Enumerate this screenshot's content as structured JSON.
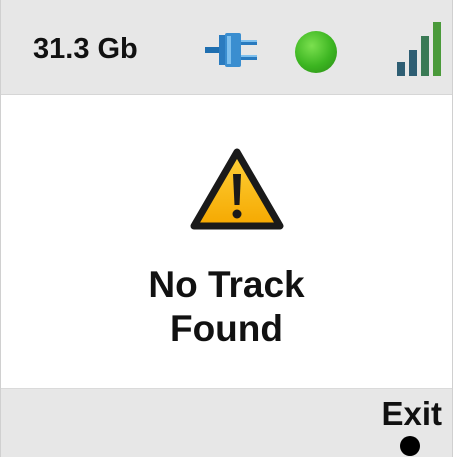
{
  "status_bar": {
    "storage": "31.3 Gb",
    "connection_icon": "usb-plug-icon",
    "status_indicator_icon": "status-dot-icon",
    "signal_icon": "signal-strength-icon",
    "status_color": "#3cb521",
    "icon_accent_color": "#2a7bbf",
    "signal_bars_active": 4,
    "signal_bars_total": 4
  },
  "main": {
    "icon": "warning-triangle-icon",
    "message_line1": "No Track",
    "message_line2": "Found",
    "warning_color": "#f5b400"
  },
  "softkeys": {
    "right_label": "Exit",
    "right_icon": "softkey-dot-icon"
  }
}
